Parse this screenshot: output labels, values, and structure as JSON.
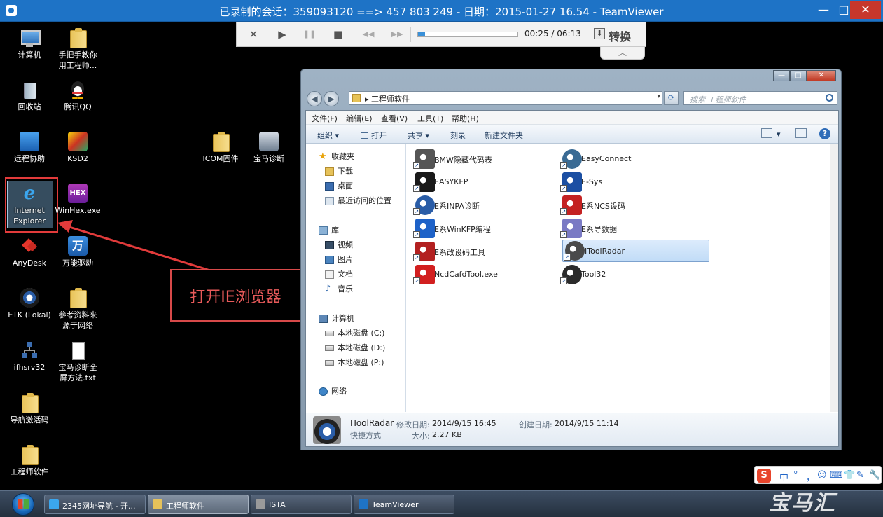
{
  "teamviewer": {
    "title": "已录制的会话：359093120 ==> 457 803 249 - 日期：2015-01-27 16.54 - TeamViewer",
    "window_buttons": {
      "minimize": "—",
      "maximize": "□",
      "close": "✕"
    }
  },
  "playback": {
    "stop": "✕",
    "play": "▶",
    "pause": "❚❚",
    "halt": "■",
    "rewind": "◀◀",
    "forward": "▶▶",
    "progress_fraction": 0.068,
    "time": "00:25 / 06:13",
    "convert_label": "转换",
    "convert_icon": "⬇",
    "collapse_tab": "︿"
  },
  "desktop": {
    "icons": [
      {
        "id": "computer",
        "label": "计算机",
        "icon": "computer-icon"
      },
      {
        "id": "manual",
        "label": "手把手教你\n用工程师...",
        "icon": "folder-icon"
      },
      {
        "id": "recycle",
        "label": "回收站",
        "icon": "recycle-bin-icon"
      },
      {
        "id": "qq",
        "label": "腾讯QQ",
        "icon": "qq-icon"
      },
      {
        "id": "remote",
        "label": "远程协助",
        "icon": "remote-assist-icon"
      },
      {
        "id": "ksd2",
        "label": "KSD2",
        "icon": "ksd2-icon"
      },
      {
        "id": "icom",
        "label": "ICOM固件",
        "icon": "folder-icon"
      },
      {
        "id": "bmwdiag",
        "label": "宝马诊断",
        "icon": "bmw-diagnosis-icon"
      },
      {
        "id": "ie",
        "label": "Internet\nExplorer",
        "icon": "internet-explorer-icon"
      },
      {
        "id": "winhex",
        "label": "WinHex.exe",
        "icon": "winhex-icon"
      },
      {
        "id": "anydesk",
        "label": "AnyDesk",
        "icon": "anydesk-icon"
      },
      {
        "id": "wanneng",
        "label": "万能驱动",
        "icon": "driver-icon"
      },
      {
        "id": "etk",
        "label": "ETK (Lokal)",
        "icon": "etk-icon"
      },
      {
        "id": "refs",
        "label": "参考资料来\n源于网络",
        "icon": "folder-icon"
      },
      {
        "id": "ifhsrv",
        "label": "ifhsrv32",
        "icon": "network-icon"
      },
      {
        "id": "bmwtxt",
        "label": "宝马诊断全\n屏方法.txt",
        "icon": "text-file-icon"
      },
      {
        "id": "nav",
        "label": "导航激活码",
        "icon": "folder-icon"
      },
      {
        "id": "engsoft",
        "label": "工程师软件",
        "icon": "folder-icon"
      }
    ]
  },
  "annotation": {
    "text": "打开IE浏览器"
  },
  "explorer": {
    "address": "工程师软件",
    "address_arrow": "▸",
    "address_dropdown": "▾",
    "refresh_icon": "⟳",
    "back_icon": "◀",
    "forward_icon": "▶",
    "search_placeholder": "搜索 工程师软件",
    "menu": [
      "文件(F)",
      "编辑(E)",
      "查看(V)",
      "工具(T)",
      "帮助(H)"
    ],
    "toolbar": {
      "organize": "组织 ▾",
      "open": "打开",
      "share": "共享 ▾",
      "burn": "刻录",
      "new_folder": "新建文件夹",
      "view_dd": "▾",
      "help": "?"
    },
    "nav": {
      "favorites": "收藏夹",
      "downloads": "下载",
      "desktop": "桌面",
      "recent": "最近访问的位置",
      "libraries": "库",
      "videos": "视频",
      "pictures": "图片",
      "documents": "文档",
      "music": "音乐",
      "computer": "计算机",
      "drive_c": "本地磁盘 (C:)",
      "drive_d": "本地磁盘 (D:)",
      "drive_p": "本地磁盘 (P:)",
      "network": "网络"
    },
    "files": [
      {
        "name": "BMW隐藏代码表",
        "icon": "database-icon",
        "color": "#555555"
      },
      {
        "name": "EASYKFP",
        "icon": "easykfp-icon",
        "color": "#1a1a1a"
      },
      {
        "name": "E系INPA诊断",
        "icon": "bmw-logo-icon",
        "color": "#2a5da7"
      },
      {
        "name": "E系WinKFP编程",
        "icon": "kfp-icon",
        "color": "#1e62c8"
      },
      {
        "name": "E系改设码工具",
        "icon": "checklist-icon",
        "color": "#b32020"
      },
      {
        "name": "NcdCafdTool.exe",
        "icon": "ncd-tool-icon",
        "color": "#d21f1f"
      },
      {
        "name": "EasyConnect",
        "icon": "easyconnect-icon",
        "color": "#3a6b94"
      },
      {
        "name": "E-Sys",
        "icon": "esys-icon",
        "color": "#1b4fa3"
      },
      {
        "name": "E系NCS设码",
        "icon": "ncs-icon",
        "color": "#c42222"
      },
      {
        "name": "E系导数据",
        "icon": "data-export-icon",
        "color": "#7a7ac4"
      },
      {
        "name": "IToolRadar",
        "icon": "itoolradar-icon",
        "color": "#4a4a4a"
      },
      {
        "name": "Tool32",
        "icon": "tool32-eye-icon",
        "color": "#2b2b2b"
      }
    ],
    "selected_file": "IToolRadar",
    "details": {
      "name": "IToolRadar",
      "type": "快捷方式",
      "modified_label": "修改日期:",
      "modified": "2014/9/15 16:45",
      "created_label": "创建日期:",
      "created": "2014/9/15 11:14",
      "size_label": "大小:",
      "size": "2.27 KB"
    }
  },
  "taskbar": {
    "tasks": [
      {
        "label": "2345网址导航 - 开...",
        "icon": "internet-explorer-icon",
        "color": "#3ba6ee"
      },
      {
        "label": "工程师软件",
        "icon": "folder-icon",
        "color": "#e6c25a"
      },
      {
        "label": "ISTA",
        "icon": "ista-icon",
        "color": "#9a9a9a"
      },
      {
        "label": "TeamViewer",
        "icon": "teamviewer-icon",
        "color": "#1e73c6"
      }
    ],
    "active_task": "工程师软件"
  },
  "ime": {
    "logo": "S",
    "items": [
      "中",
      "°",
      "，",
      "☺",
      "⌨",
      "👕",
      "✎",
      "🔧"
    ]
  },
  "watermark": "宝马汇",
  "colors": {
    "teamviewer_blue": "#1e73c6",
    "annotation_red": "#e23b3b",
    "selection_blue": "#c1dcf7"
  }
}
